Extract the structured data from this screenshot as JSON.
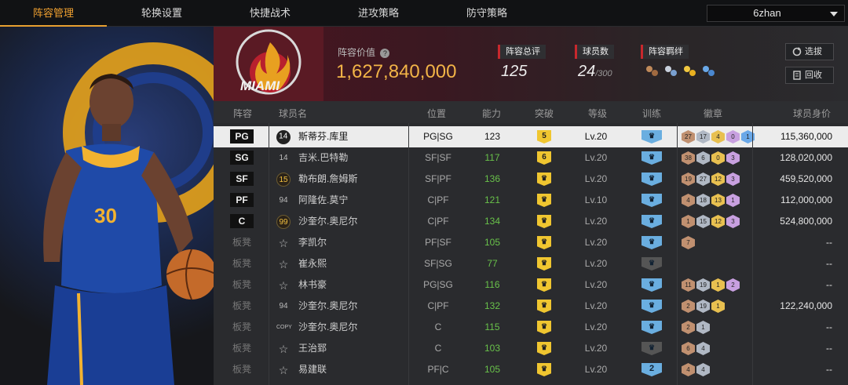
{
  "nav": {
    "tabs": [
      {
        "label": "阵容管理",
        "active": true
      },
      {
        "label": "轮换设置",
        "active": false
      },
      {
        "label": "快捷战术",
        "active": false
      },
      {
        "label": "进攻策略",
        "active": false
      },
      {
        "label": "防守策略",
        "active": false
      }
    ],
    "user": "6zhan"
  },
  "team": {
    "logo_text": "MIAMI",
    "value_label": "阵容价值",
    "value": "1,627,840,000",
    "overall_label": "阵容总评",
    "overall": "125",
    "players_label": "球员数",
    "players": "24",
    "players_max": "/300",
    "bonds_label": "阵容羁绊",
    "pick_button": "选拔",
    "recycle_button": "回收"
  },
  "table": {
    "headers": [
      "阵容",
      "球员名",
      "位置",
      "能力",
      "突破",
      "等级",
      "训练",
      "徽章",
      "球员身价"
    ],
    "rows": [
      {
        "slot": "PG",
        "starter": true,
        "jersey": "14",
        "name": "斯蒂芬.库里",
        "pos": "PG|SG",
        "ovr": "123",
        "break": "5",
        "level": "Lv.20",
        "train": "",
        "badges": [
          "27",
          "17",
          "4",
          "0",
          "1"
        ],
        "price": "115,360,000",
        "selected": true
      },
      {
        "slot": "SG",
        "starter": true,
        "jersey": "14",
        "name": "吉米.巴特勒",
        "pos": "SF|SF",
        "ovr": "117",
        "break": "6",
        "level": "Lv.20",
        "train": "",
        "badges": [
          "38",
          "6",
          "0",
          "3"
        ],
        "price": "128,020,000"
      },
      {
        "slot": "SF",
        "starter": true,
        "jersey": "15",
        "name": "勒布朗.詹姆斯",
        "pos": "SF|PF",
        "ovr": "136",
        "break": "",
        "level": "Lv.20",
        "train": "",
        "badges": [
          "19",
          "27",
          "12",
          "3"
        ],
        "price": "459,520,000"
      },
      {
        "slot": "PF",
        "starter": true,
        "jersey": "94",
        "name": "阿隆佐.莫宁",
        "pos": "C|PF",
        "ovr": "121",
        "break": "",
        "level": "Lv.10",
        "train": "",
        "badges": [
          "4",
          "18",
          "13",
          "1"
        ],
        "price": "112,000,000"
      },
      {
        "slot": "C",
        "starter": true,
        "jersey": "99",
        "name": "沙奎尔.奥尼尔",
        "pos": "C|PF",
        "ovr": "134",
        "break": "",
        "level": "Lv.20",
        "train": "",
        "badges": [
          "1",
          "15",
          "12",
          "3"
        ],
        "price": "524,800,000"
      },
      {
        "slot": "板凳",
        "starter": false,
        "jersey": "☆",
        "name": "李凯尔",
        "pos": "PF|SF",
        "ovr": "105",
        "break": "",
        "level": "Lv.20",
        "train": "",
        "badges": [
          "7"
        ],
        "price": "--"
      },
      {
        "slot": "板凳",
        "starter": false,
        "jersey": "☆",
        "name": "崔永熙",
        "pos": "SF|SG",
        "ovr": "77",
        "break": "",
        "level": "Lv.20",
        "train": "gray",
        "badges": [],
        "price": "--"
      },
      {
        "slot": "板凳",
        "starter": false,
        "jersey": "☆",
        "name": "林书豪",
        "pos": "PG|SG",
        "ovr": "116",
        "break": "",
        "level": "Lv.20",
        "train": "",
        "badges": [
          "11",
          "19",
          "1",
          "2"
        ],
        "price": "--"
      },
      {
        "slot": "板凳",
        "starter": false,
        "jersey": "94",
        "name": "沙奎尔.奥尼尔",
        "pos": "C|PF",
        "ovr": "132",
        "break": "",
        "level": "Lv.20",
        "train": "",
        "badges": [
          "2",
          "19",
          "1"
        ],
        "price": "122,240,000"
      },
      {
        "slot": "板凳",
        "starter": false,
        "jersey": "COPY",
        "name": "沙奎尔.奥尼尔",
        "pos": "C",
        "ovr": "115",
        "break": "",
        "level": "Lv.20",
        "train": "",
        "badges": [
          "2",
          "1"
        ],
        "price": "--"
      },
      {
        "slot": "板凳",
        "starter": false,
        "jersey": "☆",
        "name": "王治郅",
        "pos": "C",
        "ovr": "103",
        "break": "",
        "level": "Lv.20",
        "train": "gray",
        "badges": [
          "6",
          "4"
        ],
        "price": "--"
      },
      {
        "slot": "板凳",
        "starter": false,
        "jersey": "☆",
        "name": "易建联",
        "pos": "PF|C",
        "ovr": "105",
        "break": "",
        "level": "Lv.20",
        "train": "2",
        "badges": [
          "4",
          "4"
        ],
        "price": "--"
      }
    ]
  },
  "colors": {
    "accent": "#f0a030",
    "value": "#f2b447",
    "ovr_green": "#69c24a",
    "team_red": "#c8282d"
  }
}
